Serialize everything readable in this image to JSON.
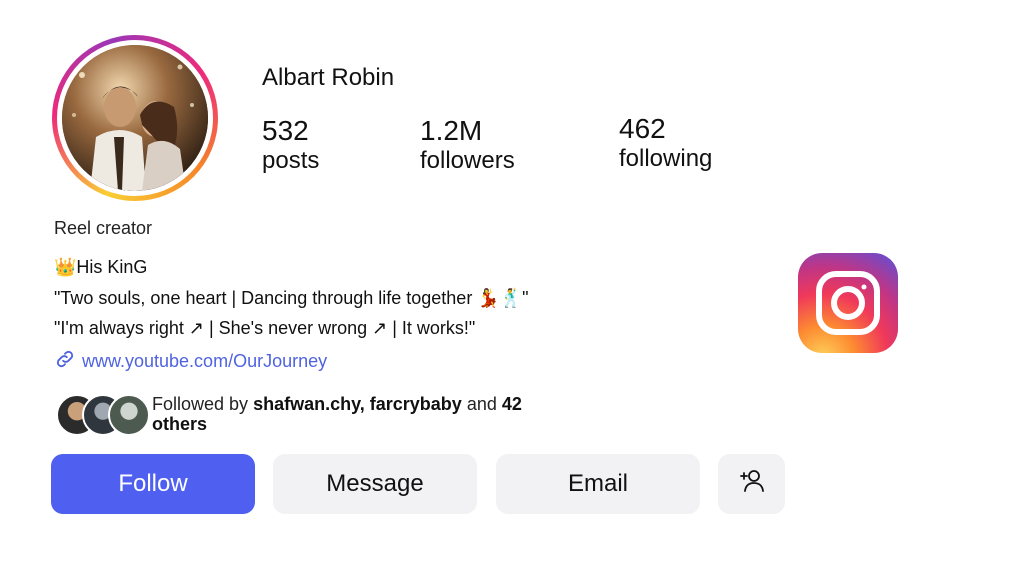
{
  "profile": {
    "name": "Albart Robin",
    "stats": {
      "posts_count": "532",
      "posts_label": "posts",
      "followers_count": "1.2M",
      "followers_label": "followers",
      "following_count": "462",
      "following_label": "following"
    },
    "category": "Reel creator",
    "bio": {
      "line1": "👑His KinG",
      "line2": "\"Two souls, one heart | Dancing through life together 💃🕺\"",
      "line3": "\"I'm always right ↗ | She's never wrong ↗ | It works!\""
    },
    "link": "www.youtube.com/OurJourney",
    "followed_by": {
      "prefix": "Followed by",
      "users": "shafwan.chy, farcrybaby",
      "suffix_and": "and",
      "others": "42 others"
    }
  },
  "actions": {
    "follow": "Follow",
    "message": "Message",
    "email": "Email"
  },
  "icons": {
    "link": "link-icon",
    "add_user": "add-user-icon",
    "brand": "instagram-logo"
  },
  "colors": {
    "follow_button": "#4f5ff0",
    "secondary_button": "#f2f2f4",
    "link": "#4f63e0"
  }
}
